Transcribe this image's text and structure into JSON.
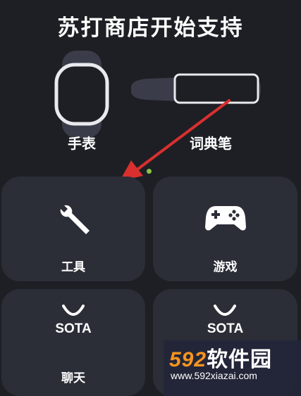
{
  "page": {
    "title": "苏打商店开始支持"
  },
  "devices": [
    {
      "label": "手表",
      "icon": "watch-icon"
    },
    {
      "label": "词典笔",
      "icon": "dictionary-pen-icon"
    }
  ],
  "categories": [
    {
      "label": "工具",
      "icon": "wrench-icon"
    },
    {
      "label": "游戏",
      "icon": "gamepad-icon"
    },
    {
      "label": "聊天",
      "icon": "sota-logo-icon",
      "logo_text": "SOTA"
    },
    {
      "label": "",
      "icon": "sota-logo-icon",
      "logo_text": "SOTA"
    }
  ],
  "watermark": {
    "num": "592",
    "cn": "软件园",
    "url": "www.592xiazai.com"
  },
  "colors": {
    "background": "#1e1f24",
    "tile": "#2b2d37",
    "arrow": "#d9302f",
    "status_dot": "#8bc34a",
    "watermark_accent": "#f7941e"
  }
}
